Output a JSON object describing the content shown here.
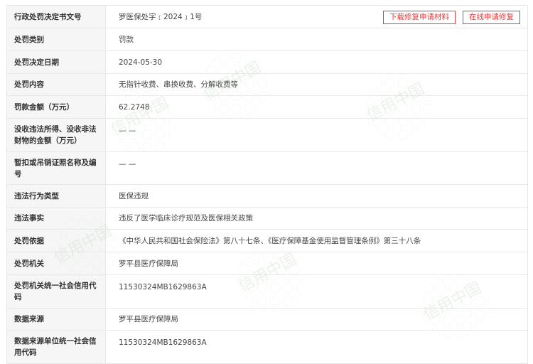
{
  "header": {
    "label": "行政处罚决定书文号",
    "value": "罗医保处字﹝2024﹞1号",
    "download_button": "下载修复申请材料",
    "online_button": "在线申请修复"
  },
  "rows": [
    {
      "label": "处罚类别",
      "value": "罚款"
    },
    {
      "label": "处罚决定日期",
      "value": "2024-05-30"
    },
    {
      "label": "处罚内容",
      "value": "无指针收费、串换收费、分解收费等"
    },
    {
      "label": "罚款金额（万元）",
      "value": "62.2748"
    },
    {
      "label": "没收违法所得、没收非法财物的金额（万元）",
      "value": "— —"
    },
    {
      "label": "暂扣或吊销证照名称及编号",
      "value": "— —"
    },
    {
      "label": "违法行为类型",
      "value": "医保违规"
    },
    {
      "label": "违法事实",
      "value": "违反了医学临床诊疗规范及医保相关政策"
    },
    {
      "label": "处罚依据",
      "value": "《中华人民共和国社会保险法》第八十七条、《医疗保障基金使用监督管理条例》第三十八条"
    },
    {
      "label": "处罚机关",
      "value": "罗平县医疗保障局"
    },
    {
      "label": "处罚机关统一社会信用代码",
      "value": "11530324MB1629863A"
    },
    {
      "label": "数据来源",
      "value": "罗平县医疗保障局"
    },
    {
      "label": "数据来源单位统一社会信用代码",
      "value": "11530324MB1629863A"
    }
  ],
  "watermark": {
    "text": "信用中国",
    "color": "#b5d3b5"
  },
  "colors": {
    "accent": "#e4393c",
    "label_bg": "#f6f6f6",
    "border": "#e9e9e9"
  }
}
